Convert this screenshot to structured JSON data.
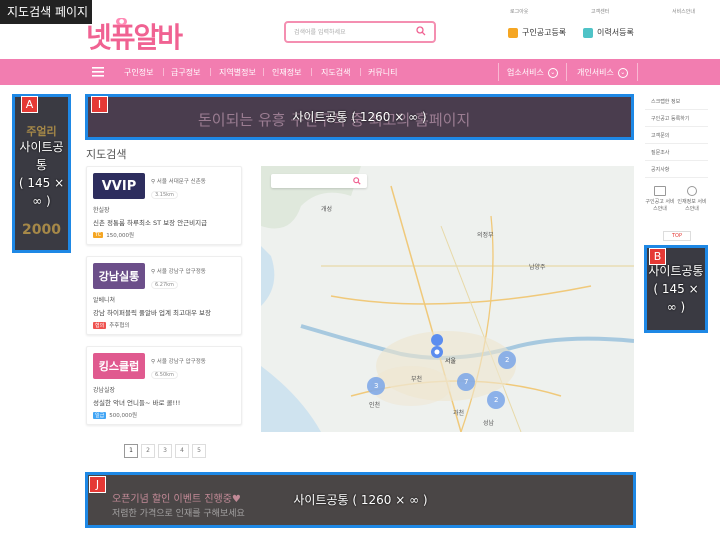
{
  "page_tag": "지도검색 페이지",
  "header": {
    "logo_text": "넷퓨알바",
    "search_placeholder": "검색어를 입력하세요",
    "top_links": [
      "로그아웃",
      "고객센터",
      "서비스안내"
    ],
    "btn_job_post": "구인공고등록",
    "btn_resume": "이력서등록"
  },
  "nav": {
    "items": [
      "구인정보",
      "급구정보",
      "지역별정보",
      "인재정보",
      "지도검색",
      "커뮤니티"
    ],
    "business_service": "업소서비스",
    "personal_service": "개인서비스"
  },
  "ads": {
    "left": {
      "label": "A",
      "text": "사이트공통",
      "size": "( 145 × ∞ )",
      "bg_text": "주얼리",
      "bg_text2": "2000"
    },
    "top": {
      "label": "I",
      "text": "사이트공통 ( 1260 × ∞ )",
      "bg_text": "돈이되는 유흥 구인구직 중 최고의 홈페이지"
    },
    "right": {
      "label": "B",
      "text": "사이트공통",
      "size": "( 145 × ∞ )"
    },
    "bottom": {
      "label": "J",
      "text": "사이트공통 ( 1260 × ∞ )",
      "bg_text": "오픈기념 할인 이벤트 진행중♥",
      "bg_text2": "저렴한 가격으로 인재를 구해보세요"
    }
  },
  "section_title": "지도검색",
  "listings": [
    {
      "thumb": "VVIP",
      "thumb_color": "#2e2e5e",
      "location": "서울 서대문구 신촌동",
      "distance": "3.15km",
      "name": "한실장",
      "desc": "신촌 정통룸 하루최소 ST 보장 안근비지급",
      "pay_type": "TC",
      "pay_color": "#f5a623",
      "pay": "150,000원"
    },
    {
      "thumb": "강남실통",
      "thumb_color": "#6c4f8a",
      "location": "서울 강남구 압구정동",
      "distance": "6.27km",
      "name": "알베니쳐",
      "desc": "강남 하이퍼블릭 풀알바 업계 최고대우 보장",
      "pay_type": "협의",
      "pay_color": "#ef5350",
      "pay": "추후협의"
    },
    {
      "thumb": "킹스클럽",
      "thumb_color": "#e05a8f",
      "location": "서울 강남구 압구정동",
      "distance": "6.50km",
      "name": "강남실장",
      "desc": "성실한 악녀 언니들~ 바로 콜!!!",
      "pay_type": "일급",
      "pay_color": "#42a5f5",
      "pay": "500,000원"
    }
  ],
  "pagination": [
    "1",
    "2",
    "3",
    "4",
    "5"
  ],
  "map": {
    "labels": [
      "개성",
      "의정부",
      "남양주",
      "서울",
      "인천",
      "과천",
      "부천",
      "성남"
    ],
    "clusters": [
      "2",
      "3",
      "7",
      "2"
    ]
  },
  "sidebar": {
    "items": [
      "스크랩한 정보",
      "구인공고 등록하기",
      "고객문의",
      "질문조사",
      "공지사항"
    ],
    "icon_labels": [
      "구인공고 서비스안내",
      "인재정보 서비스안내"
    ],
    "top": "TOP"
  }
}
